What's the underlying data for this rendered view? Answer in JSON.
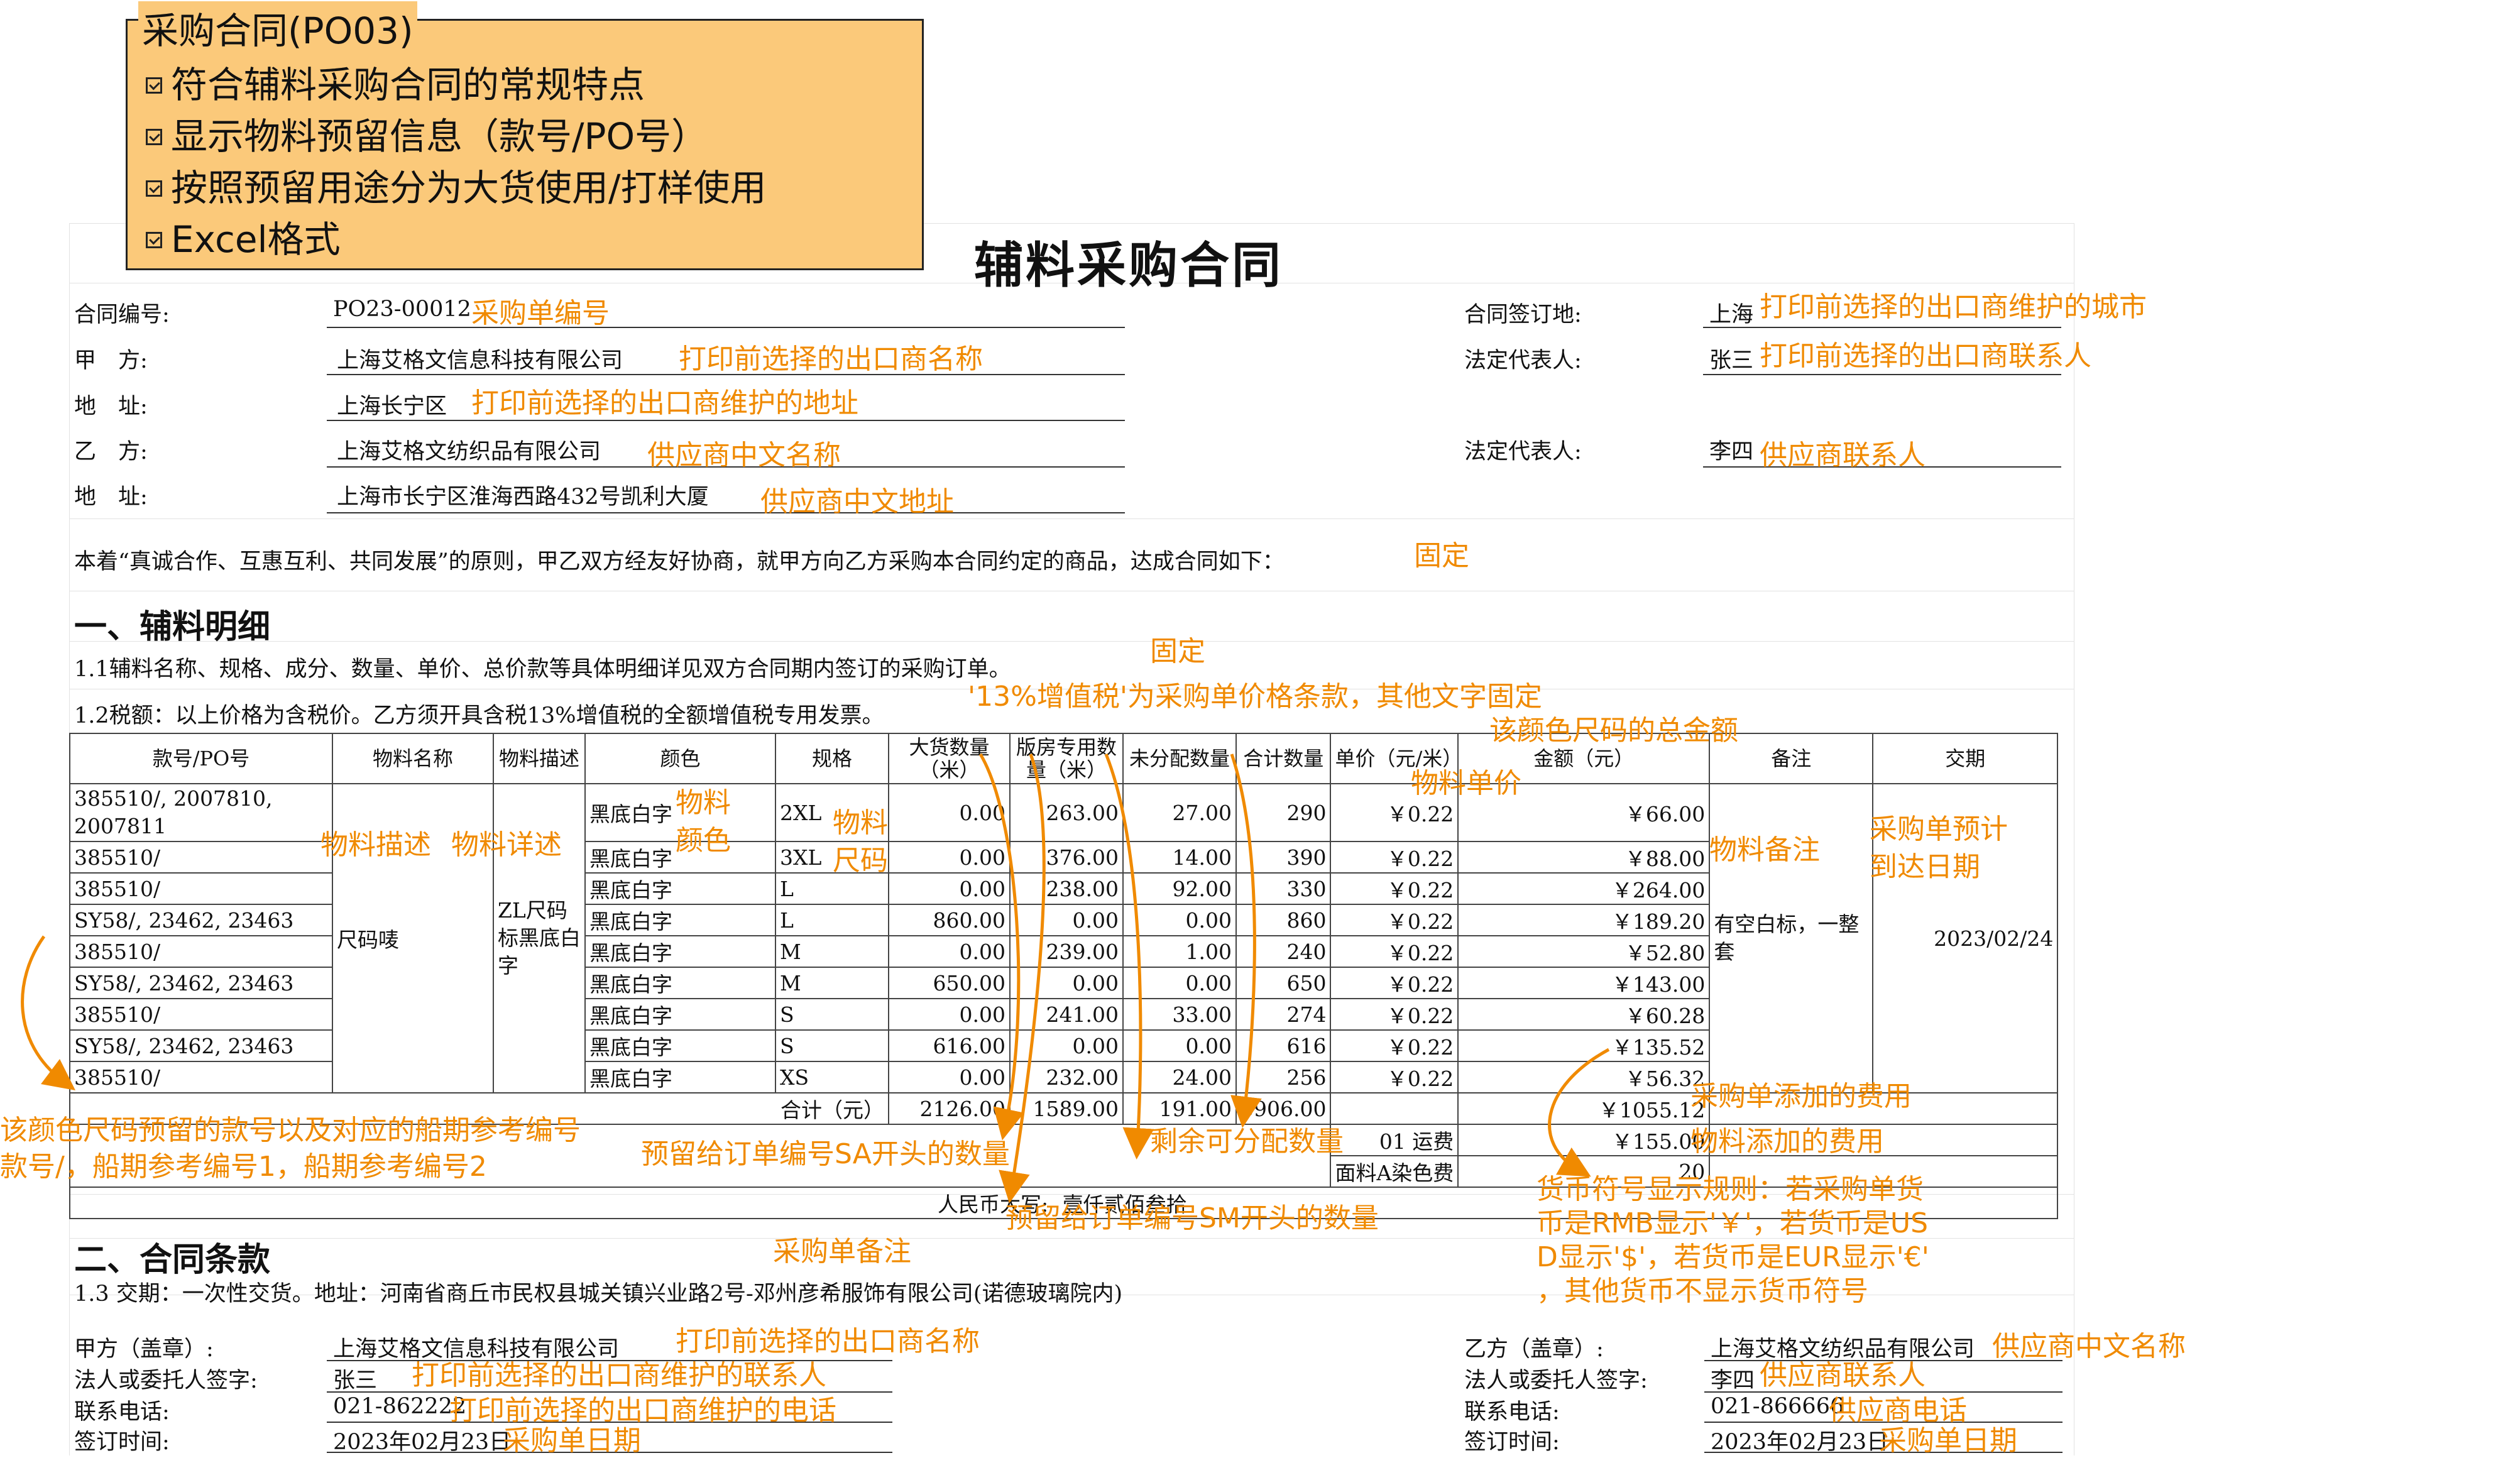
{
  "callout": {
    "title": "采购合同(PO03)",
    "items": [
      "符合辅料采购合同的常规特点",
      "显示物料预留信息（款号/PO号）",
      "按照预留用途分为大货使用/打样使用",
      "Excel格式"
    ]
  },
  "doc_title": "辅料采购合同",
  "header": {
    "contract_no_label": "合同编号:",
    "contract_no": "PO23-00012",
    "party_a_label": "甲　方:",
    "party_a": "上海艾格文信息科技有限公司",
    "addr_a_label": "地　址:",
    "addr_a": "上海长宁区",
    "party_b_label": "乙　方:",
    "party_b": "上海艾格文纺织品有限公司",
    "addr_b_label": "地　址:",
    "addr_b": "上海市长宁区淮海西路432号凯利大厦",
    "sign_place_label": "合同签订地:",
    "sign_place": "上海",
    "rep_a_label": "法定代表人:",
    "rep_a": "张三",
    "rep_b_label": "法定代表人:",
    "rep_b": "李四"
  },
  "intro": "本着“真诚合作、互惠互利、共同发展”的原则，甲乙双方经友好协商，就甲方向乙方采购本合同约定的商品，达成合同如下：",
  "section1": {
    "title": "一、辅料明细",
    "p1": "1.1辅料名称、规格、成分、数量、单价、总价款等具体明细详见双方合同期内签订的采购订单。",
    "p2": "1.2税额：以上价格为含税价。乙方须开具含税13%增值税的全额增值税专用发票。"
  },
  "table": {
    "headers": [
      "款号/PO号",
      "物料名称",
      "物料描述",
      "颜色",
      "规格",
      "大货数量（米）",
      "版房专用数量（米）",
      "未分配数量",
      "合计数量",
      "单价（元/米）",
      "金额（元）",
      "备注",
      "交期"
    ],
    "material_name": "尺码唛",
    "material_desc": "ZL尺码标黑底白字",
    "remark": "有空白标，一整套",
    "delivery": "2023/02/24",
    "rows": [
      {
        "po": "385510/, 2007810, 2007811",
        "color": "黑底白字",
        "size": "2XL",
        "bulk": "0.00",
        "sample": "263.00",
        "unalloc": "27.00",
        "total": "290",
        "price": "￥0.22",
        "amount": "￥66.00"
      },
      {
        "po": "385510/",
        "color": "黑底白字",
        "size": "3XL",
        "bulk": "0.00",
        "sample": "376.00",
        "unalloc": "14.00",
        "total": "390",
        "price": "￥0.22",
        "amount": "￥88.00"
      },
      {
        "po": "385510/",
        "color": "黑底白字",
        "size": "L",
        "bulk": "0.00",
        "sample": "238.00",
        "unalloc": "92.00",
        "total": "330",
        "price": "￥0.22",
        "amount": "￥264.00"
      },
      {
        "po": "SY58/, 23462, 23463",
        "color": "黑底白字",
        "size": "L",
        "bulk": "860.00",
        "sample": "0.00",
        "unalloc": "0.00",
        "total": "860",
        "price": "￥0.22",
        "amount": "￥189.20"
      },
      {
        "po": "385510/",
        "color": "黑底白字",
        "size": "M",
        "bulk": "0.00",
        "sample": "239.00",
        "unalloc": "1.00",
        "total": "240",
        "price": "￥0.22",
        "amount": "￥52.80"
      },
      {
        "po": "SY58/, 23462, 23463",
        "color": "黑底白字",
        "size": "M",
        "bulk": "650.00",
        "sample": "0.00",
        "unalloc": "0.00",
        "total": "650",
        "price": "￥0.22",
        "amount": "￥143.00"
      },
      {
        "po": "385510/",
        "color": "黑底白字",
        "size": "S",
        "bulk": "0.00",
        "sample": "241.00",
        "unalloc": "33.00",
        "total": "274",
        "price": "￥0.22",
        "amount": "￥60.28"
      },
      {
        "po": "SY58/, 23462, 23463",
        "color": "黑底白字",
        "size": "S",
        "bulk": "616.00",
        "sample": "0.00",
        "unalloc": "0.00",
        "total": "616",
        "price": "￥0.22",
        "amount": "￥135.52"
      },
      {
        "po": "385510/",
        "color": "黑底白字",
        "size": "XS",
        "bulk": "0.00",
        "sample": "232.00",
        "unalloc": "24.00",
        "total": "256",
        "price": "￥0.22",
        "amount": "￥56.32"
      }
    ],
    "sum_label": "合计（元）",
    "sum_bulk": "2126.00",
    "sum_sample": "1589.00",
    "sum_unalloc": "191.00",
    "sum_total": "3906.00",
    "sum_amount": "￥1055.12",
    "fee1_label": "01 运费",
    "fee1": "￥155.00",
    "fee2_label": "面料A染色费",
    "fee2": "20",
    "rmb_label": "人民币大写:",
    "rmb": "壹仟贰佰叁拾"
  },
  "section2": {
    "title": "二、合同条款",
    "p1": "1.3 交期：一次性交货。地址：河南省商丘市民权县城关镇兴业路2号-邓州彦希服饰有限公司(诺德玻璃院内)"
  },
  "footer": {
    "a_seal_label": "甲方（盖章）:",
    "a_seal": "上海艾格文信息科技有限公司",
    "a_rep_label": "法人或委托人签字:",
    "a_rep": "张三",
    "a_tel_label": "联系电话:",
    "a_tel": "021-862222",
    "a_date_label": "签订时间:",
    "a_date": "2023年02月23日",
    "b_seal_label": "乙方（盖章）:",
    "b_seal": "上海艾格文纺织品有限公司",
    "b_rep_label": "法人或委托人签字:",
    "b_rep": "李四",
    "b_tel_label": "联系电话:",
    "b_tel": "021-866666",
    "b_date_label": "签订时间:",
    "b_date": "2023年02月23日"
  },
  "notes": {
    "po_no": "采购单编号",
    "exporter_city": "打印前选择的出口商维护的城市",
    "exporter_name": "打印前选择的出口商名称",
    "exporter_contact": "打印前选择的出口商联系人",
    "exporter_addr": "打印前选择的出口商维护的地址",
    "supplier_cn_name": "供应商中文名称",
    "supplier_contact": "供应商联系人",
    "supplier_cn_addr": "供应商中文地址",
    "fixed1": "固定",
    "fixed2": "固定",
    "vat": "'13%增值税'为采购单价格条款，其他文字固定",
    "color_size_total": "该颜色尺码的总金额",
    "material_desc": "物料描述",
    "material_detail": "物料详述",
    "material_color": "物料颜色",
    "material_size": "物料尺码",
    "material_price": "物料单价",
    "material_remark": "物料备注",
    "po_eta": "采购单预计到达日期",
    "reserved_style": "该颜色尺码预留的款号以及对应的船期参考编号",
    "style_format": "款号/，船期参考编号1，船期参考编号2",
    "sa_qty": "预留给订单编号SA开头的数量",
    "remaining": "剩余可分配数量",
    "sm_qty": "预留给订单编号SM开头的数量",
    "po_fee": "采购单添加的费用",
    "material_fee": "物料添加的费用",
    "currency_rule": [
      "货币符号显示规则：若采购单货",
      "币是RMB显示'￥'，若货币是US",
      "D显示'$'，若货币是EUR显示'€'",
      "，其他货币不显示货币符号"
    ],
    "po_remark": "采购单备注",
    "f_exporter_name": "打印前选择的出口商名称",
    "f_exporter_contact": "打印前选择的出口商维护的联系人",
    "f_exporter_tel": "打印前选择的出口商维护的电话",
    "f_po_date": "采购单日期",
    "f_supplier_name": "供应商中文名称",
    "f_supplier_contact": "供应商联系人",
    "f_supplier_tel": "供应商电话",
    "f_po_date2": "采购单日期"
  }
}
